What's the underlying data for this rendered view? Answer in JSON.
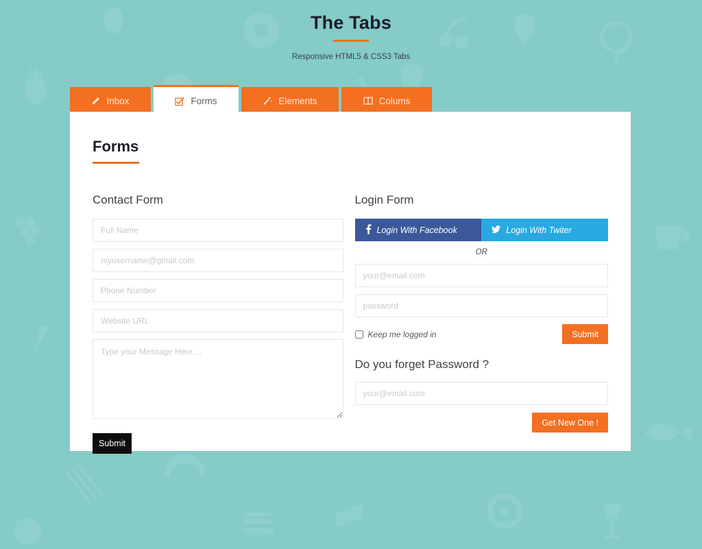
{
  "header": {
    "title": "The Tabs",
    "subtitle": "Responsive HTML5 & CSS3 Tabs"
  },
  "tabs": [
    {
      "label": "Inbox",
      "icon": "pencil-icon",
      "active": false
    },
    {
      "label": "Forms",
      "icon": "checkbox-icon",
      "active": true
    },
    {
      "label": "Elements",
      "icon": "magic-wand-icon",
      "active": false
    },
    {
      "label": "Colums",
      "icon": "columns-icon",
      "active": false
    }
  ],
  "panel": {
    "heading": "Forms"
  },
  "contact_form": {
    "title": "Contact Form",
    "fields": [
      {
        "name": "full-name",
        "placeholder": "Full Name",
        "value": ""
      },
      {
        "name": "email",
        "placeholder": "myusername@gmail.com",
        "value": ""
      },
      {
        "name": "phone",
        "placeholder": "Phone Number",
        "value": ""
      },
      {
        "name": "website",
        "placeholder": "Website URL",
        "value": ""
      }
    ],
    "message_placeholder": "Type your Message Here....",
    "message_value": "",
    "submit_label": "Submit"
  },
  "login_form": {
    "title": "Login Form",
    "facebook_label": "Login With Facebook",
    "twitter_label": "Login With Twiter",
    "or_label": "OR",
    "email_placeholder": "your@email.com",
    "email_value": "",
    "password_placeholder": "password",
    "password_value": "",
    "keep_logged_label": "Keep me logged in",
    "keep_logged_checked": false,
    "submit_label": "Submit"
  },
  "forgot_password": {
    "title": "Do you forget Password ?",
    "email_placeholder": "your@email.com",
    "email_value": "",
    "button_label": "Get New One !"
  },
  "colors": {
    "background": "#85cbc8",
    "accent": "#f36f21",
    "panel": "#ffffff",
    "dark_button": "#0d0d0d",
    "facebook": "#3b5998",
    "twitter": "#29a9e0",
    "heading": "#1d1d26"
  }
}
